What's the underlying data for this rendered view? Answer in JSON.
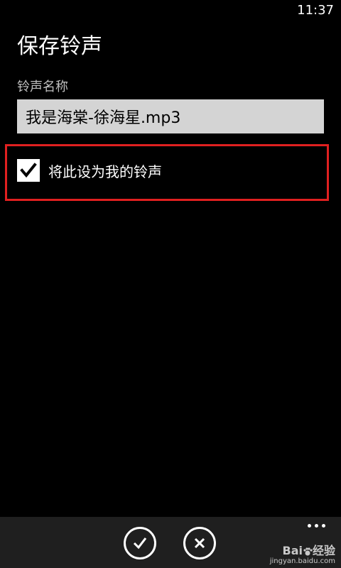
{
  "status_bar": {
    "time": "11:37"
  },
  "page": {
    "title": "保存铃声"
  },
  "ringtone_form": {
    "name_label": "铃声名称",
    "name_value": "我是海棠-徐海星.mp3",
    "set_as_ringtone": {
      "label": "将此设为我的铃声",
      "checked": true
    }
  },
  "app_bar": {
    "buttons": [
      {
        "name": "save",
        "icon": "check-icon"
      },
      {
        "name": "cancel",
        "icon": "close-icon"
      }
    ],
    "more_icon": "more-dots-icon"
  },
  "watermark": {
    "main_a": "Bai",
    "main_b": "经验",
    "sub": "jingyan.baidu.com"
  },
  "colors": {
    "background": "#000000",
    "app_bar": "#1f1f1f",
    "input_bg": "#d4d4d4",
    "highlight": "#e02020",
    "label": "#bfbfbf"
  }
}
